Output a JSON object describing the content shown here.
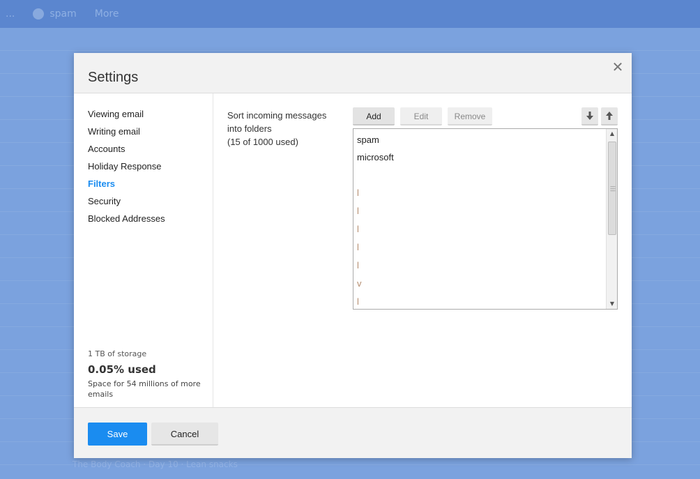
{
  "background": {
    "topbar_items": [
      "...",
      "spam",
      "More"
    ],
    "bottom_text": "The Body Coach · Day 10 · Lean snacks"
  },
  "dialog": {
    "title": "Settings",
    "close_icon": "close-icon"
  },
  "sidebar": {
    "items": [
      {
        "label": "Viewing email"
      },
      {
        "label": "Writing email"
      },
      {
        "label": "Accounts"
      },
      {
        "label": "Holiday Response"
      },
      {
        "label": "Filters",
        "active": true
      },
      {
        "label": "Security"
      },
      {
        "label": "Blocked Addresses"
      }
    ],
    "storage": {
      "capacity": "1 TB of storage",
      "used": "0.05% used",
      "space": "Space for 54 millions of more emails"
    }
  },
  "filters": {
    "desc_line1": "Sort incoming messages",
    "desc_line2": "into folders",
    "desc_line3": "(15 of 1000 used)",
    "buttons": {
      "add": "Add",
      "edit": "Edit",
      "remove": "Remove",
      "down_icon": "arrow-down-icon",
      "up_icon": "arrow-up-icon"
    },
    "list": [
      "spam",
      "microsoft",
      "",
      "l",
      "l",
      "l",
      "l",
      "l",
      "v",
      "l"
    ]
  },
  "footer": {
    "save": "Save",
    "cancel": "Cancel"
  },
  "colors": {
    "accent": "#1a8cf0",
    "background": "#7ba2de"
  }
}
